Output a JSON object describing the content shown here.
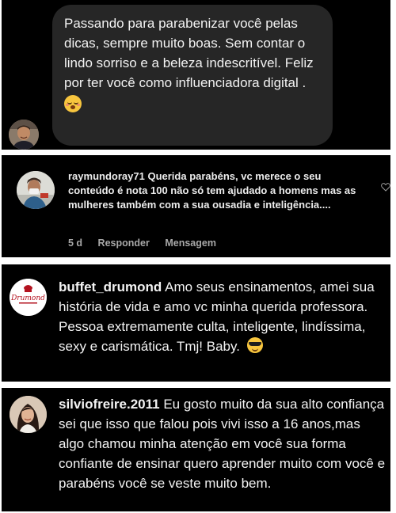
{
  "dm": {
    "message": "Passando para parabenizar você pelas dicas, sempre muito boas. Sem contar o lindo sorriso e a beleza indescritível. Feliz por ter você como influenciadora digital ."
  },
  "comments": [
    {
      "username": "raymundoray71",
      "text": "Querida parabéns, vc merece o seu conteúdo é nota 100 não só tem ajudado a homens mas as mulheres também com a sua ousadia e inteligência....",
      "time": "5 d",
      "reply_label": "Responder",
      "message_label": "Mensagem"
    },
    {
      "username": "buffet_drumond",
      "text": "Amo seus ensinamentos, amei sua história de vida e amo vc minha querida professora. Pessoa extremamente culta, inteligente, lindíssima, sexy e carismática. Tmj! Baby.",
      "logo_text": "Drumond"
    },
    {
      "username": "silviofreire.2011",
      "text": "Eu gosto muito da sua alto confiança sei que isso que falou pois vivi isso a 16 anos,mas algo chamou minha atenção em você sua forma confiante de ensinar quero aprender muito com você e parabéns você se veste muito bem."
    }
  ],
  "icons": {
    "dm_emoji": "face-with-closed-eyes-icon",
    "sunglasses_emoji": "sunglasses-face-icon",
    "like": "heart-icon"
  },
  "colors": {
    "background": "#000000",
    "bubble": "#262626",
    "text": "#f2f2f2",
    "meta": "#a8a8a8"
  }
}
